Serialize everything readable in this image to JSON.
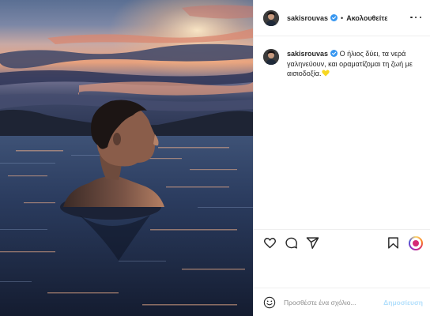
{
  "photo": {
    "alt_subject": "man-in-water-at-sunset"
  },
  "header": {
    "username": "sakisrouvas",
    "separator": "•",
    "follow_label": "Ακολουθείτε",
    "verified": true
  },
  "caption": {
    "username": "sakisrouvas",
    "text": "Ο ήλιος δύει, τα νερά γαληνεύουν, και οραματίζομαι τη ζωή με αισιοδοξία."
  },
  "actions": {
    "like_icon": "heart-outline-icon",
    "comment_icon": "speech-bubble-icon",
    "share_icon": "paper-plane-icon",
    "save_icon": "bookmark-icon",
    "reels_icon": "reels-ring-icon"
  },
  "add_comment": {
    "placeholder": "Προσθέστε ένα σχόλιο...",
    "post_label": "Δημοσίευση"
  },
  "colors": {
    "verified_blue": "#3897f0",
    "post_button_disabled": "#b2dffc",
    "emoji_yellow": "#f7d722",
    "border": "#efefef"
  }
}
